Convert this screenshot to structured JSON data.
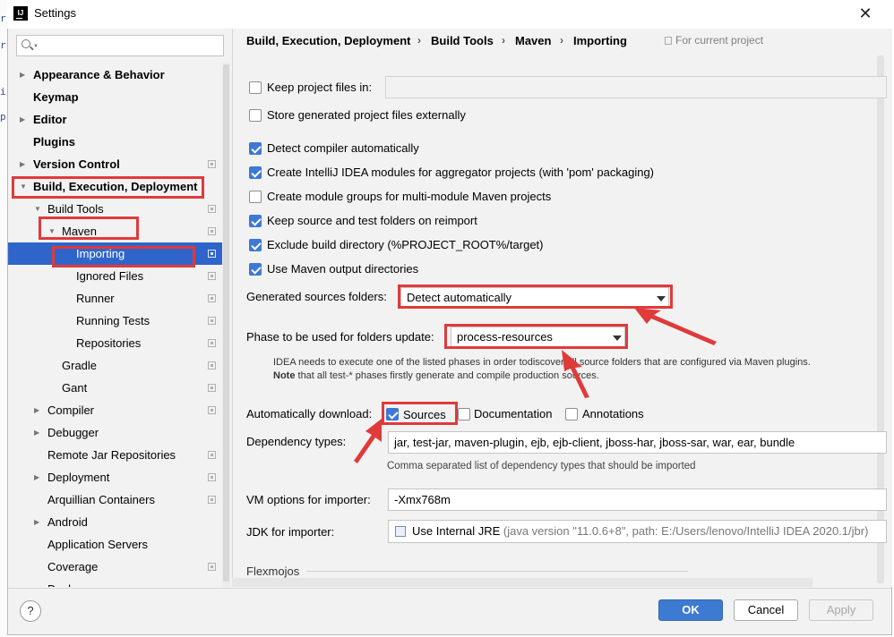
{
  "window": {
    "title": "Settings",
    "app_icon": "IJ",
    "close": "✕"
  },
  "search": {
    "placeholder": ""
  },
  "sidebar": {
    "items": [
      {
        "label": "Appearance & Behavior",
        "arrow": "▶"
      },
      {
        "label": "Keymap"
      },
      {
        "label": "Editor",
        "arrow": "▶"
      },
      {
        "label": "Plugins"
      },
      {
        "label": "Version Control",
        "arrow": "▶"
      },
      {
        "label": "Build, Execution, Deployment",
        "arrow": "▼"
      },
      {
        "label": "Build Tools",
        "arrow": "▼"
      },
      {
        "label": "Maven",
        "arrow": "▼"
      },
      {
        "label": "Importing"
      },
      {
        "label": "Ignored Files"
      },
      {
        "label": "Runner"
      },
      {
        "label": "Running Tests"
      },
      {
        "label": "Repositories"
      },
      {
        "label": "Gradle"
      },
      {
        "label": "Gant"
      },
      {
        "label": "Compiler",
        "arrow": "▶"
      },
      {
        "label": "Debugger",
        "arrow": "▶"
      },
      {
        "label": "Remote Jar Repositories"
      },
      {
        "label": "Deployment",
        "arrow": "▶"
      },
      {
        "label": "Arquillian Containers"
      },
      {
        "label": "Android",
        "arrow": "▶"
      },
      {
        "label": "Application Servers"
      },
      {
        "label": "Coverage"
      },
      {
        "label": "Dock",
        "arrow": "▶"
      }
    ]
  },
  "breadcrumb": {
    "items": [
      "Build, Execution, Deployment",
      "Build Tools",
      "Maven",
      "Importing"
    ],
    "separator": "›",
    "scope": "For current project"
  },
  "options": {
    "keep_project_files": {
      "label": "Keep project files in:",
      "checked": false
    },
    "store_externally": {
      "label": "Store generated project files externally",
      "checked": false
    },
    "detect_compiler": {
      "label": "Detect compiler automatically",
      "checked": true
    },
    "create_modules": {
      "label": "Create IntelliJ IDEA modules for aggregator projects (with 'pom' packaging)",
      "checked": true
    },
    "create_groups": {
      "label": "Create module groups for multi-module Maven projects",
      "checked": false
    },
    "keep_source": {
      "label": "Keep source and test folders on reimport",
      "checked": true
    },
    "exclude_build": {
      "label": "Exclude build directory (%PROJECT_ROOT%/target)",
      "checked": true
    },
    "use_output": {
      "label": "Use Maven output directories",
      "checked": true
    }
  },
  "generated_sources": {
    "label": "Generated sources folders:",
    "value": "Detect automatically"
  },
  "phase": {
    "label": "Phase to be used for folders update:",
    "value": "process-resources",
    "hint_line1": "IDEA needs to execute one of the listed phases in order todiscover all source folders that are configured via Maven plugins.",
    "hint_note_bold": "Note",
    "hint_line2": " that all test-* phases firstly generate and compile production sources."
  },
  "auto_download": {
    "label": "Automatically download:",
    "sources": {
      "label": "Sources",
      "checked": true
    },
    "documentation": {
      "label": "Documentation",
      "checked": false
    },
    "annotations": {
      "label": "Annotations",
      "checked": false
    }
  },
  "dependency_types": {
    "label": "Dependency types:",
    "value": "jar, test-jar, maven-plugin, ejb, ejb-client, jboss-har, jboss-sar, war, ear, bundle",
    "hint": "Comma separated list of dependency types that should be imported"
  },
  "vm_options": {
    "label": "VM options for importer:",
    "value": "-Xmx768m"
  },
  "jdk": {
    "label": "JDK for importer:",
    "value": "Use Internal JRE",
    "detail": "(java version \"11.0.6+8\", path: E:/Users/lenovo/IntelliJ IDEA 2020.1/jbr)"
  },
  "section": {
    "flexmojos": "Flexmojos"
  },
  "footer": {
    "help": "?",
    "ok": "OK",
    "cancel": "Cancel",
    "apply": "Apply"
  },
  "colors": {
    "selection": "#2f65ca",
    "annotation_red": "#e03a3a",
    "checkbox_blue": "#3d78d6"
  }
}
